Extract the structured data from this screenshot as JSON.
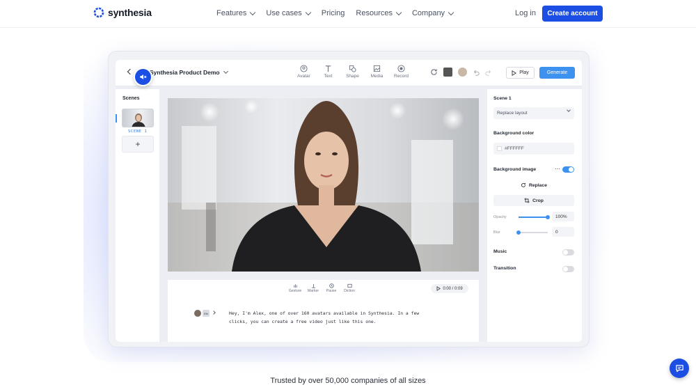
{
  "brand": {
    "name": "synthesia",
    "accent": "#1c4ee4"
  },
  "nav": {
    "items": [
      {
        "label": "Features",
        "dropdown": true
      },
      {
        "label": "Use cases",
        "dropdown": true
      },
      {
        "label": "Pricing",
        "dropdown": false
      },
      {
        "label": "Resources",
        "dropdown": true
      },
      {
        "label": "Company",
        "dropdown": true
      }
    ],
    "login": "Log in",
    "cta": "Create account"
  },
  "editor": {
    "project_title": "Synthesia Product Demo",
    "tools": [
      {
        "label": "Avatar",
        "icon": "avatar-icon"
      },
      {
        "label": "Text",
        "icon": "text-icon"
      },
      {
        "label": "Shape",
        "icon": "shape-icon"
      },
      {
        "label": "Media",
        "icon": "media-icon"
      },
      {
        "label": "Record",
        "icon": "record-icon"
      }
    ],
    "play_label": "Play",
    "generate_label": "Generate",
    "scenes_title": "Scenes",
    "scene_label": "SCENE 1",
    "add_scene": "+",
    "script_tools": [
      {
        "label": "Gesture",
        "icon": "gesture-icon"
      },
      {
        "label": "Marker",
        "icon": "marker-icon"
      },
      {
        "label": "Pause",
        "icon": "pause-icon"
      },
      {
        "label": "Diction",
        "icon": "diction-icon"
      }
    ],
    "timer": "0:00 / 0:09",
    "lang_badge": "EN",
    "script_text": "Hey, I'm Alex, one of over 160 avatars available in Synthesia. In a few clicks, you can create a free video just like this one."
  },
  "properties": {
    "scene_title": "Scene 1",
    "layout_value": "Replace layout",
    "bg_color_label": "Background color",
    "bg_color_value": "#FFFFFF",
    "bg_image_label": "Background image",
    "bg_image_on": true,
    "replace_label": "Replace",
    "crop_label": "Crop",
    "opacity_label": "Opacity",
    "opacity_value": "100%",
    "opacity_level": 1.0,
    "blur_label": "Blur",
    "blur_value": "0",
    "blur_level": 0.0,
    "music_label": "Music",
    "music_on": false,
    "transition_label": "Transition",
    "transition_on": false
  },
  "footer": {
    "trusted": "Trusted by over 50,000 companies of all sizes"
  }
}
